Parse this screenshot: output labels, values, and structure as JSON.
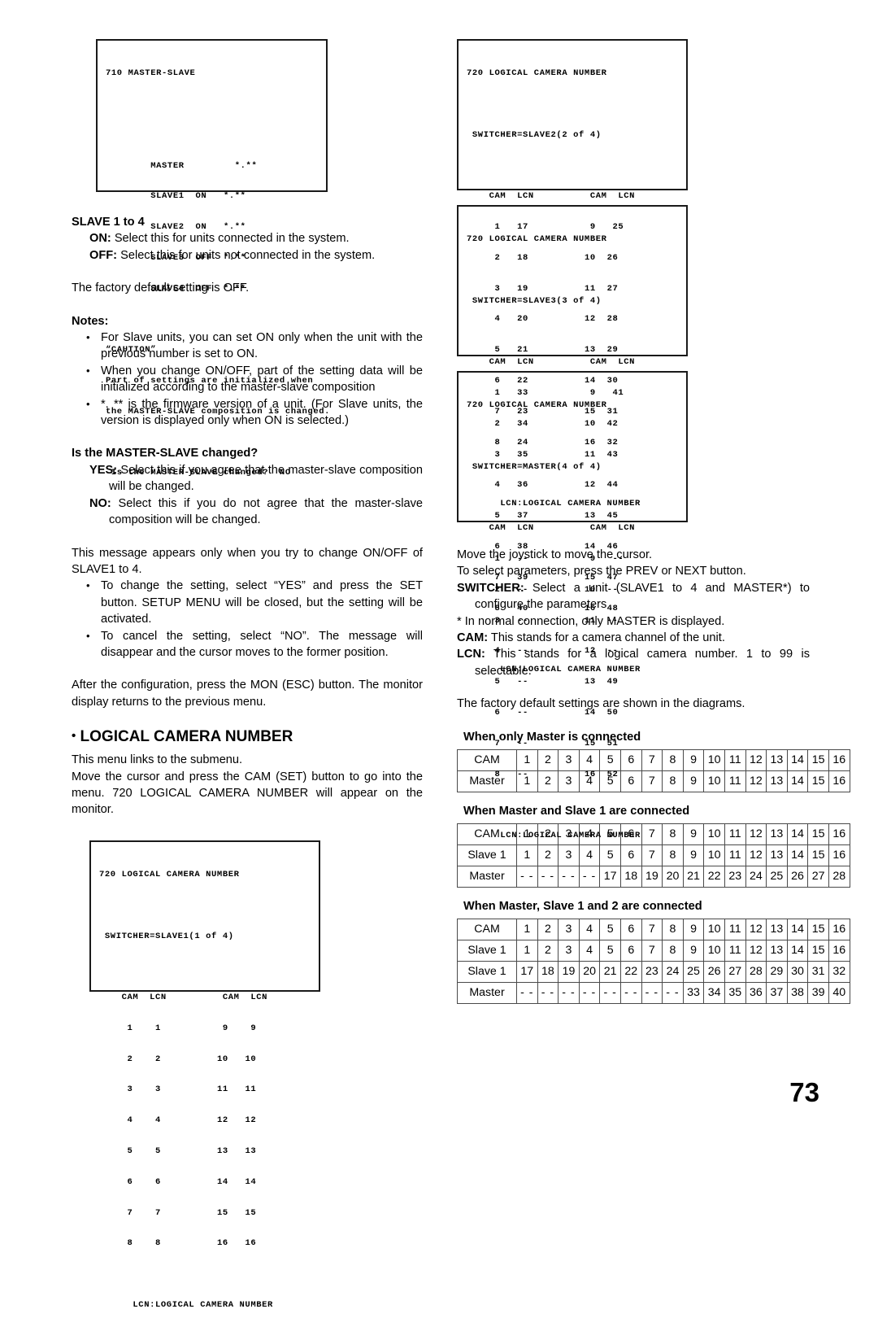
{
  "page_number": "73",
  "osd_710": {
    "title": "710 MASTER-SLAVE",
    "rows": [
      {
        "name": "MASTER",
        "state": "",
        "version": "*.**"
      },
      {
        "name": "SLAVE1",
        "state": "ON",
        "version": "*.**"
      },
      {
        "name": "SLAVE2",
        "state": "ON",
        "version": "*.**"
      },
      {
        "name": "SLAVE3",
        "state": "OFF",
        "version": "*.**"
      },
      {
        "name": "SLAVE4",
        "state": "OFF",
        "version": "*.**"
      }
    ],
    "caution_label": "“CAUTION”",
    "caution_line1": "Part of settings are initialized when",
    "caution_line2": "the MASTER-SLAVE composition is changed.",
    "prompt": " Is the MASTER-SLAVE changed?  NO"
  },
  "osd_720_common": {
    "title": "720 LOGICAL CAMERA NUMBER",
    "col_head_left": "CAM  LCN",
    "col_head_right": "CAM  LCN",
    "footer": "LCN:LOGICAL CAMERA NUMBER"
  },
  "osd_720_screens": [
    {
      "id": "slave1",
      "switcher": " SWITCHER=SLAVE1(1 of 4)",
      "left": [
        {
          "cam": "1",
          "lcn": "1"
        },
        {
          "cam": "2",
          "lcn": "2"
        },
        {
          "cam": "3",
          "lcn": "3"
        },
        {
          "cam": "4",
          "lcn": "4"
        },
        {
          "cam": "5",
          "lcn": "5"
        },
        {
          "cam": "6",
          "lcn": "6"
        },
        {
          "cam": "7",
          "lcn": "7"
        },
        {
          "cam": "8",
          "lcn": "8"
        }
      ],
      "right": [
        {
          "cam": "9",
          "lcn": "9"
        },
        {
          "cam": "10",
          "lcn": "10"
        },
        {
          "cam": "11",
          "lcn": "11"
        },
        {
          "cam": "12",
          "lcn": "12"
        },
        {
          "cam": "13",
          "lcn": "13"
        },
        {
          "cam": "14",
          "lcn": "14"
        },
        {
          "cam": "15",
          "lcn": "15"
        },
        {
          "cam": "16",
          "lcn": "16"
        }
      ]
    },
    {
      "id": "slave2",
      "switcher": " SWITCHER=SLAVE2(2 of 4)",
      "left": [
        {
          "cam": "1",
          "lcn": "17"
        },
        {
          "cam": "2",
          "lcn": "18"
        },
        {
          "cam": "3",
          "lcn": "19"
        },
        {
          "cam": "4",
          "lcn": "20"
        },
        {
          "cam": "5",
          "lcn": "21"
        },
        {
          "cam": "6",
          "lcn": "22"
        },
        {
          "cam": "7",
          "lcn": "23"
        },
        {
          "cam": "8",
          "lcn": "24"
        }
      ],
      "right": [
        {
          "cam": "9",
          "lcn": "25"
        },
        {
          "cam": "10",
          "lcn": "26"
        },
        {
          "cam": "11",
          "lcn": "27"
        },
        {
          "cam": "12",
          "lcn": "28"
        },
        {
          "cam": "13",
          "lcn": "29"
        },
        {
          "cam": "14",
          "lcn": "30"
        },
        {
          "cam": "15",
          "lcn": "31"
        },
        {
          "cam": "16",
          "lcn": "32"
        }
      ]
    },
    {
      "id": "slave3",
      "switcher": " SWITCHER=SLAVE3(3 of 4)",
      "left": [
        {
          "cam": "1",
          "lcn": "33"
        },
        {
          "cam": "2",
          "lcn": "34"
        },
        {
          "cam": "3",
          "lcn": "35"
        },
        {
          "cam": "4",
          "lcn": "36"
        },
        {
          "cam": "5",
          "lcn": "37"
        },
        {
          "cam": "6",
          "lcn": "38"
        },
        {
          "cam": "7",
          "lcn": "39"
        },
        {
          "cam": "8",
          "lcn": "40"
        }
      ],
      "right": [
        {
          "cam": "9",
          "lcn": "41"
        },
        {
          "cam": "10",
          "lcn": "42"
        },
        {
          "cam": "11",
          "lcn": "43"
        },
        {
          "cam": "12",
          "lcn": "44"
        },
        {
          "cam": "13",
          "lcn": "45"
        },
        {
          "cam": "14",
          "lcn": "46"
        },
        {
          "cam": "15",
          "lcn": "47"
        },
        {
          "cam": "16",
          "lcn": "48"
        }
      ]
    },
    {
      "id": "master",
      "switcher": " SWITCHER=MASTER(4 of 4)",
      "left": [
        {
          "cam": "1",
          "lcn": "--"
        },
        {
          "cam": "2",
          "lcn": "--"
        },
        {
          "cam": "3",
          "lcn": "--"
        },
        {
          "cam": "4",
          "lcn": "--"
        },
        {
          "cam": "5",
          "lcn": "--"
        },
        {
          "cam": "6",
          "lcn": "--"
        },
        {
          "cam": "7",
          "lcn": "--"
        },
        {
          "cam": "8",
          "lcn": "--"
        }
      ],
      "right": [
        {
          "cam": "9",
          "lcn": "--"
        },
        {
          "cam": "10",
          "lcn": "--"
        },
        {
          "cam": "11",
          "lcn": "--"
        },
        {
          "cam": "12",
          "lcn": "--"
        },
        {
          "cam": "13",
          "lcn": "49"
        },
        {
          "cam": "14",
          "lcn": "50"
        },
        {
          "cam": "15",
          "lcn": "51"
        },
        {
          "cam": "16",
          "lcn": "52"
        }
      ]
    }
  ],
  "left_column": {
    "slave_heading": "SLAVE 1 to 4",
    "on_label": "ON:",
    "on_text": " Select this for units connected in the system.",
    "off_label": "OFF:",
    "off_text": " Select this for units not connected in the system.",
    "factory_default": "The factory default setting is OFF.",
    "notes_heading": "Notes:",
    "notes": [
      "For Slave units, you can set ON only when the unit with the previous number is set to ON.",
      "When you change ON/OFF, part of the setting data will be initialized according to the master-slave composition",
      "*. ** is the firmware version of a unit. (For Slave units, the version is displayed only when ON is selected.)"
    ],
    "changed_heading": "Is the MASTER-SLAVE changed?",
    "yes_label": "YES:",
    "yes_text": " Select this if you agree that the master-slave composition will be changed.",
    "no_label": "NO:",
    "no_text": " Select this if you do not agree that the master-slave composition will be changed.",
    "message_para": "This message appears only when you try to change ON/OFF of SLAVE1 to 4.",
    "message_bullets": [
      "To change the setting, select “YES” and press the SET button. SETUP MENU will be closed, but the setting will be activated.",
      "To cancel the setting, select “NO”. The message will disappear and the cursor moves to the former position."
    ],
    "after_config": "After the configuration, press the MON (ESC) button. The monitor display returns to the previous menu.",
    "section_heading": "LOGICAL CAMERA NUMBER",
    "section_bullet": "•",
    "submenu_line": "This menu links to the submenu.",
    "submenu_para": "Move the cursor and press the CAM (SET) button to go into the menu. 720 LOGICAL CAMERA NUMBER will appear on the monitor."
  },
  "right_column": {
    "joystick_line": "Move the joystick to move the cursor.",
    "params_line": "To select parameters, press the PREV or NEXT button.",
    "switcher_label": "SWITCHER:",
    "switcher_text": " Select a unit (SLAVE1 to 4 and MASTER*) to configure the parameters",
    "footnote": "* In normal connection, only MASTER is displayed.",
    "cam_label": "CAM:",
    "cam_text": " This stands for a camera channel of the unit.",
    "lcn_label": "LCN:",
    "lcn_text": " This stands for a logical camera number. 1 to 99 is selectable.",
    "factory_diagrams": "The factory default settings are shown in the diagrams."
  },
  "tables": [
    {
      "caption": "When only Master is connected",
      "rows": [
        {
          "label": "CAM",
          "values": [
            "1",
            "2",
            "3",
            "4",
            "5",
            "6",
            "7",
            "8",
            "9",
            "10",
            "11",
            "12",
            "13",
            "14",
            "15",
            "16"
          ]
        },
        {
          "label": "Master",
          "values": [
            "1",
            "2",
            "3",
            "4",
            "5",
            "6",
            "7",
            "8",
            "9",
            "10",
            "11",
            "12",
            "13",
            "14",
            "15",
            "16"
          ]
        }
      ]
    },
    {
      "caption": "When Master and Slave 1 are connected",
      "rows": [
        {
          "label": "CAM",
          "values": [
            "1",
            "2",
            "3",
            "4",
            "5",
            "6",
            "7",
            "8",
            "9",
            "10",
            "11",
            "12",
            "13",
            "14",
            "15",
            "16"
          ]
        },
        {
          "label": "Slave 1",
          "values": [
            "1",
            "2",
            "3",
            "4",
            "5",
            "6",
            "7",
            "8",
            "9",
            "10",
            "11",
            "12",
            "13",
            "14",
            "15",
            "16"
          ]
        },
        {
          "label": "Master",
          "values": [
            "- -",
            "- -",
            "- -",
            "- -",
            "17",
            "18",
            "19",
            "20",
            "21",
            "22",
            "23",
            "24",
            "25",
            "26",
            "27",
            "28"
          ]
        }
      ]
    },
    {
      "caption": "When Master, Slave 1 and 2 are connected",
      "rows": [
        {
          "label": "CAM",
          "values": [
            "1",
            "2",
            "3",
            "4",
            "5",
            "6",
            "7",
            "8",
            "9",
            "10",
            "11",
            "12",
            "13",
            "14",
            "15",
            "16"
          ]
        },
        {
          "label": "Slave 1",
          "values": [
            "1",
            "2",
            "3",
            "4",
            "5",
            "6",
            "7",
            "8",
            "9",
            "10",
            "11",
            "12",
            "13",
            "14",
            "15",
            "16"
          ]
        },
        {
          "label": "Slave 1",
          "values": [
            "17",
            "18",
            "19",
            "20",
            "21",
            "22",
            "23",
            "24",
            "25",
            "26",
            "27",
            "28",
            "29",
            "30",
            "31",
            "32"
          ]
        },
        {
          "label": "Master",
          "values": [
            "- -",
            "- -",
            "- -",
            "- -",
            "- -",
            "- -",
            "- -",
            "- -",
            "33",
            "34",
            "35",
            "36",
            "37",
            "38",
            "39",
            "40"
          ]
        }
      ]
    }
  ]
}
